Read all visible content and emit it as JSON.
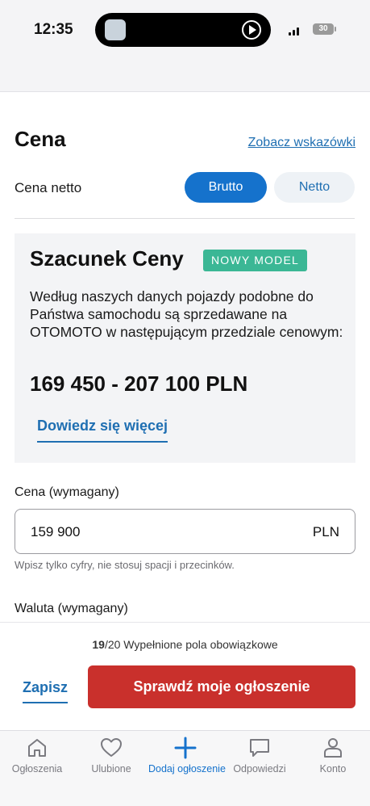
{
  "status_bar": {
    "time": "12:35",
    "battery": "30"
  },
  "header": {
    "title": "Cena",
    "hint_link": "Zobacz wskazówki"
  },
  "net_price": {
    "label": "Cena netto",
    "options": [
      "Brutto",
      "Netto"
    ],
    "selected": "Brutto"
  },
  "estimate": {
    "title": "Szacunek Ceny",
    "badge": "NOWY MODEL",
    "description": "Według naszych danych pojazdy podobne do Państwa samochodu są sprzedawane na OTOMOTO w następującym przedziale cenowym:",
    "range": "169 450 - 207 100 PLN",
    "learn_more": "Dowiedz się więcej"
  },
  "price_field": {
    "label": "Cena (wymagany)",
    "value": "159 900",
    "unit": "PLN",
    "helper": "Wpisz tylko cyfry, nie stosuj spacji i przecinków."
  },
  "currency_field": {
    "label": "Waluta (wymagany)"
  },
  "footer": {
    "progress_done": "19",
    "progress_total": "/20",
    "progress_text": "Wypełnione pola obowiązkowe",
    "save_label": "Zapisz",
    "check_label": "Sprawdź moje ogłoszenie"
  },
  "tabbar": {
    "items": [
      {
        "label": "Ogłoszenia",
        "icon": "home-icon"
      },
      {
        "label": "Ulubione",
        "icon": "heart-icon"
      },
      {
        "label": "Dodaj ogłoszenie",
        "icon": "plus-icon"
      },
      {
        "label": "Odpowiedzi",
        "icon": "chat-icon"
      },
      {
        "label": "Konto",
        "icon": "user-icon"
      }
    ],
    "active": "Dodaj ogłoszenie"
  },
  "colors": {
    "primary": "#1572cc",
    "link": "#1f6fb2",
    "badge": "#3bb795",
    "cta": "#c9302c"
  }
}
